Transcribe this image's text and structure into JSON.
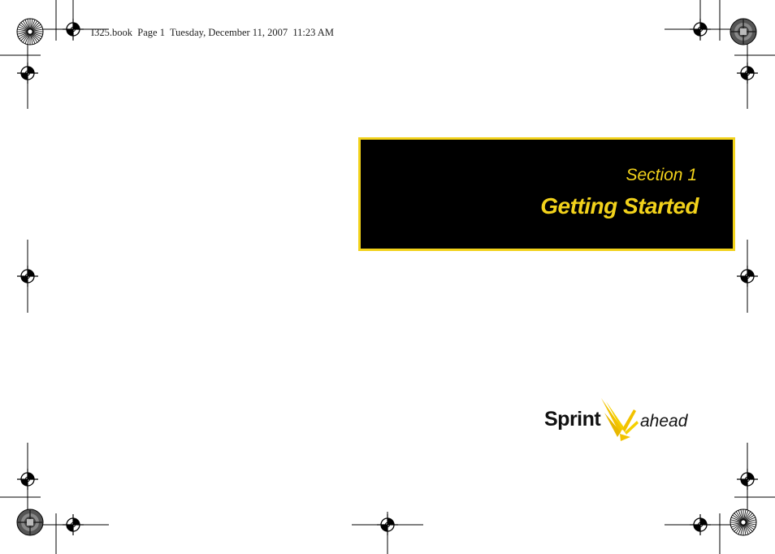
{
  "print_header": {
    "text": "I325.book  Page 1  Tuesday, December 11, 2007  11:23 AM"
  },
  "section": {
    "label": "Section 1",
    "title": "Getting Started"
  },
  "logo": {
    "brand": "Sprint",
    "tagline": "ahead"
  },
  "colors": {
    "accent_yellow": "#f2d21b",
    "box_background": "#000000",
    "text": "#111111"
  },
  "icons": [
    "registration-mark-icon",
    "color-wheel-icon",
    "sprint-wing-icon"
  ]
}
